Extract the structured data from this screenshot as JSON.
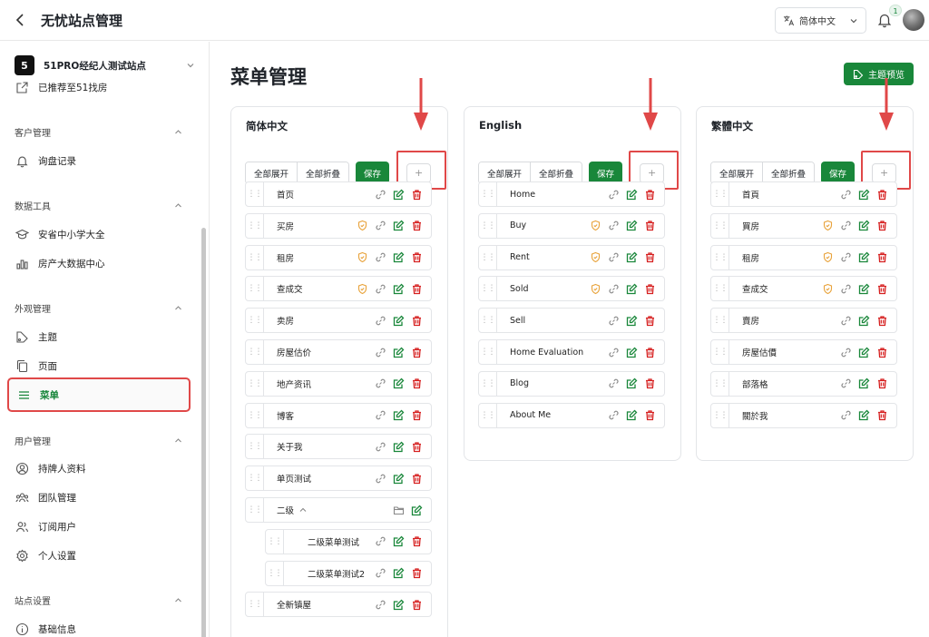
{
  "app": {
    "title": "无忧站点管理"
  },
  "header": {
    "language": "简体中文",
    "notification_count": "1"
  },
  "sidebar": {
    "site_number": "5",
    "site_name": "51PRO经纪人测试站点",
    "recommend": "已推荐至51找房",
    "sections": [
      {
        "title": "客户管理",
        "items": [
          {
            "label": "询盘记录",
            "icon": "bell-icon"
          }
        ]
      },
      {
        "title": "数据工具",
        "items": [
          {
            "label": "安省中小学大全",
            "icon": "graduation-cap-icon"
          },
          {
            "label": "房产大数据中心",
            "icon": "bar-chart-icon"
          }
        ]
      },
      {
        "title": "外观管理",
        "items": [
          {
            "label": "主题",
            "icon": "theme-icon"
          },
          {
            "label": "页面",
            "icon": "pages-icon"
          },
          {
            "label": "菜单",
            "icon": "menu-icon"
          }
        ]
      },
      {
        "title": "用户管理",
        "items": [
          {
            "label": "持牌人资料",
            "icon": "user-circle-icon"
          },
          {
            "label": "团队管理",
            "icon": "team-icon"
          },
          {
            "label": "订阅用户",
            "icon": "users-icon"
          },
          {
            "label": "个人设置",
            "icon": "gear-icon"
          }
        ]
      },
      {
        "title": "站点设置",
        "items": [
          {
            "label": "基础信息",
            "icon": "info-icon"
          }
        ]
      }
    ],
    "active_item": "菜单"
  },
  "main": {
    "page_title": "菜单管理",
    "preview_button": "主题预览",
    "toolbar": {
      "expand_all": "全部展开",
      "collapse_all": "全部折叠",
      "save": "保存",
      "add": "+"
    },
    "panels": [
      {
        "title": "简体中文",
        "items": [
          {
            "label": "首页",
            "shield": false,
            "folder": false,
            "level": 1
          },
          {
            "label": "买房",
            "shield": true,
            "folder": false,
            "level": 1
          },
          {
            "label": "租房",
            "shield": true,
            "folder": false,
            "level": 1
          },
          {
            "label": "查成交",
            "shield": true,
            "folder": false,
            "level": 1
          },
          {
            "label": "卖房",
            "shield": false,
            "folder": false,
            "level": 1
          },
          {
            "label": "房屋估价",
            "shield": false,
            "folder": false,
            "level": 1
          },
          {
            "label": "地产资讯",
            "shield": false,
            "folder": false,
            "level": 1
          },
          {
            "label": "博客",
            "shield": false,
            "folder": false,
            "level": 1
          },
          {
            "label": "关于我",
            "shield": false,
            "folder": false,
            "level": 1
          },
          {
            "label": "单页测试",
            "shield": false,
            "folder": false,
            "level": 1
          },
          {
            "label": "二级",
            "shield": false,
            "folder": true,
            "level": 1
          },
          {
            "label": "二级菜单测试",
            "shield": false,
            "folder": false,
            "level": 2
          },
          {
            "label": "二级菜单测试2",
            "shield": false,
            "folder": false,
            "level": 2
          },
          {
            "label": "全新镇屋",
            "shield": false,
            "folder": false,
            "level": 1
          }
        ]
      },
      {
        "title": "English",
        "items": [
          {
            "label": "Home",
            "shield": false,
            "folder": false,
            "level": 1
          },
          {
            "label": "Buy",
            "shield": true,
            "folder": false,
            "level": 1
          },
          {
            "label": "Rent",
            "shield": true,
            "folder": false,
            "level": 1
          },
          {
            "label": "Sold",
            "shield": true,
            "folder": false,
            "level": 1
          },
          {
            "label": "Sell",
            "shield": false,
            "folder": false,
            "level": 1
          },
          {
            "label": "Home Evaluation",
            "shield": false,
            "folder": false,
            "level": 1
          },
          {
            "label": "Blog",
            "shield": false,
            "folder": false,
            "level": 1
          },
          {
            "label": "About Me",
            "shield": false,
            "folder": false,
            "level": 1
          }
        ]
      },
      {
        "title": "繁體中文",
        "items": [
          {
            "label": "首頁",
            "shield": false,
            "folder": false,
            "level": 1
          },
          {
            "label": "買房",
            "shield": true,
            "folder": false,
            "level": 1
          },
          {
            "label": "租房",
            "shield": true,
            "folder": false,
            "level": 1
          },
          {
            "label": "查成交",
            "shield": true,
            "folder": false,
            "level": 1
          },
          {
            "label": "賣房",
            "shield": false,
            "folder": false,
            "level": 1
          },
          {
            "label": "房屋估價",
            "shield": false,
            "folder": false,
            "level": 1
          },
          {
            "label": "部落格",
            "shield": false,
            "folder": false,
            "level": 1
          },
          {
            "label": "關於我",
            "shield": false,
            "folder": false,
            "level": 1
          }
        ]
      }
    ]
  },
  "colors": {
    "accent": "#19873a",
    "highlight": "#e04848",
    "shield": "#e8a23a",
    "delete": "#d62020",
    "edit": "#19873a"
  }
}
